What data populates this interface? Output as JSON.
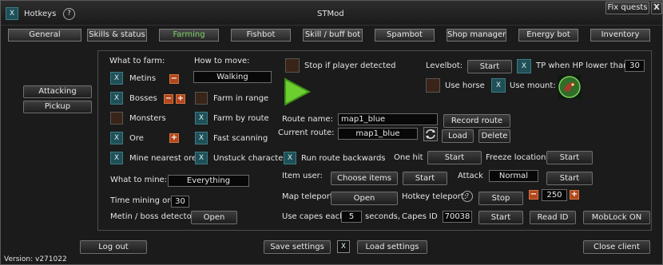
{
  "window": {
    "title": "STMod",
    "hotkeys_label": "Hotkeys",
    "help_glyph": "?",
    "fix_quests_label": "Fix quests",
    "close_glyph": "X"
  },
  "tabs": [
    "General",
    "Skills & status",
    "Farming",
    "Fishbot",
    "Skill / buff bot",
    "Spambot",
    "Shop manager",
    "Energy bot",
    "Inventory"
  ],
  "active_tab": "Farming",
  "sidebar": {
    "attacking": "Attacking",
    "pickup": "Pickup"
  },
  "farm": {
    "header": "What to farm:",
    "metins": "Metins",
    "bosses": "Bosses",
    "monsters": "Monsters",
    "ore": "Ore",
    "mine_nearest_ore": "Mine nearest ore",
    "what_to_mine_label": "What to mine:",
    "what_to_mine_value": "Everything",
    "time_mining_label": "Time mining ore",
    "time_mining_value": "30",
    "detector_label": "Metin / boss detector",
    "detector_button": "Open"
  },
  "move": {
    "header": "How to move:",
    "value": "Walking",
    "farm_in_range": "Farm in range",
    "farm_by_route": "Farm by route",
    "fast_scanning": "Fast scanning",
    "unstuck_character": "Unstuck character"
  },
  "controls": {
    "stop_if_player": "Stop if player detected",
    "route_name_label": "Route name:",
    "route_name_value": "map1_blue",
    "current_route_label": "Current route:",
    "current_route_value": "map1_blue",
    "record_route": "Record route",
    "load": "Load",
    "delete": "Delete",
    "run_route_backwards": "Run route backwards"
  },
  "levelbot": {
    "label": "Levelbot:",
    "start": "Start",
    "tp_label": "TP when HP lower than",
    "tp_value": "30",
    "use_horse": "Use horse",
    "use_mount": "Use mount:"
  },
  "misc": {
    "one_hit_label": "One hit",
    "one_hit_start": "Start",
    "freeze_label": "Freeze location:",
    "freeze_start": "Start",
    "item_user_label": "Item user:",
    "choose_items": "Choose items",
    "item_user_start": "Start",
    "attack_label": "Attack",
    "attack_value": "Normal",
    "attack_start": "Start",
    "map_teleport_label": "Map teleport",
    "map_teleport_open": "Open",
    "hotkey_teleport_label": "Hotkey teleport:",
    "hotkey_teleport_stop": "Stop",
    "hotkey_teleport_value": "250",
    "capes_label": "Use capes each",
    "capes_value": "5",
    "capes_seconds": "seconds,",
    "capes_id_label": "Capes ID",
    "capes_id_value": "70038",
    "capes_start": "Start",
    "read_id": "Read ID",
    "moblock": "MobLock ON"
  },
  "footer": {
    "log_out": "Log out",
    "save_settings": "Save settings",
    "load_settings": "Load settings",
    "close_client": "Close client",
    "version": "Version:  v271022"
  },
  "glyphs": {
    "check": "X",
    "minus": "−",
    "plus": "+",
    "help": "?"
  },
  "colors": {
    "accent_green": "#7fd36a",
    "checkbox_on": "#1f4f57",
    "checkbox_off": "#3a2418",
    "stepper": "#b2471c",
    "play": "#6ccf2f"
  }
}
